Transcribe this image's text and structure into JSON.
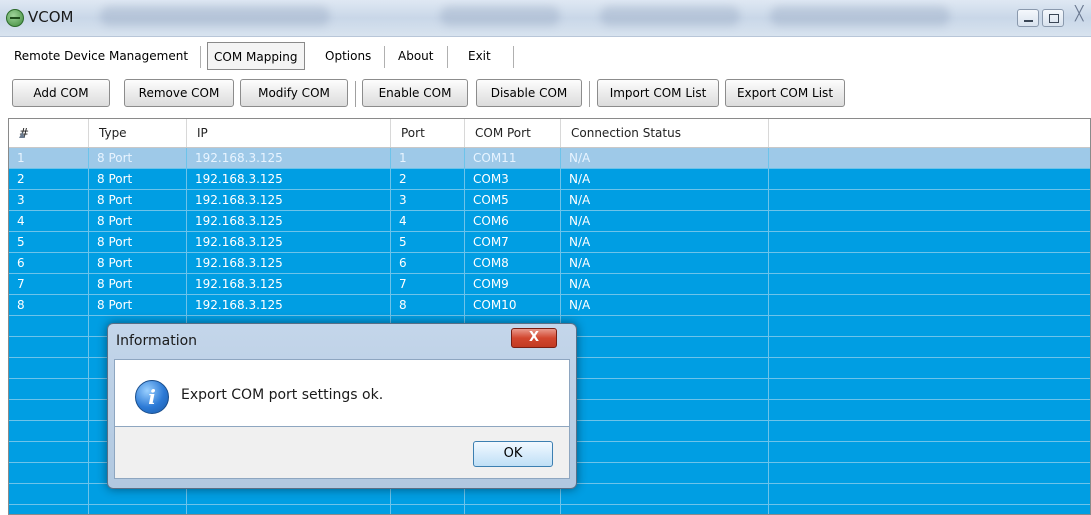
{
  "window": {
    "title": "VCOM",
    "close_glyph": "╳"
  },
  "menu": {
    "items": [
      {
        "label": "Remote Device Management"
      },
      {
        "label": "COM Mapping"
      },
      {
        "label": "Options"
      },
      {
        "label": "About"
      },
      {
        "label": "Exit"
      }
    ],
    "active": "COM Mapping"
  },
  "toolbar": {
    "buttons": [
      {
        "label": "Add COM"
      },
      {
        "label": "Remove COM"
      },
      {
        "label": "Modify COM"
      },
      {
        "label": "Enable COM"
      },
      {
        "label": "Disable COM"
      },
      {
        "label": "Import COM List"
      },
      {
        "label": "Export COM List"
      }
    ]
  },
  "table": {
    "columns": [
      "#",
      "Type",
      "IP",
      "Port",
      "COM Port",
      "Connection Status"
    ],
    "rows": [
      {
        "num": "1",
        "type": "8 Port",
        "ip": "192.168.3.125",
        "port": "1",
        "com": "COM11",
        "status": "N/A"
      },
      {
        "num": "2",
        "type": "8 Port",
        "ip": "192.168.3.125",
        "port": "2",
        "com": "COM3",
        "status": "N/A"
      },
      {
        "num": "3",
        "type": "8 Port",
        "ip": "192.168.3.125",
        "port": "3",
        "com": "COM5",
        "status": "N/A"
      },
      {
        "num": "4",
        "type": "8 Port",
        "ip": "192.168.3.125",
        "port": "4",
        "com": "COM6",
        "status": "N/A"
      },
      {
        "num": "5",
        "type": "8 Port",
        "ip": "192.168.3.125",
        "port": "5",
        "com": "COM7",
        "status": "N/A"
      },
      {
        "num": "6",
        "type": "8 Port",
        "ip": "192.168.3.125",
        "port": "6",
        "com": "COM8",
        "status": "N/A"
      },
      {
        "num": "7",
        "type": "8 Port",
        "ip": "192.168.3.125",
        "port": "7",
        "com": "COM9",
        "status": "N/A"
      },
      {
        "num": "8",
        "type": "8 Port",
        "ip": "192.168.3.125",
        "port": "8",
        "com": "COM10",
        "status": "N/A"
      }
    ],
    "selected_row": "1"
  },
  "dialog": {
    "title": "Information",
    "message": "Export COM port settings ok.",
    "ok_label": "OK",
    "close_glyph": "X",
    "icon_glyph": "i"
  },
  "colors": {
    "table_background": "#009ee3",
    "selected_row": "#9ec9e8"
  }
}
